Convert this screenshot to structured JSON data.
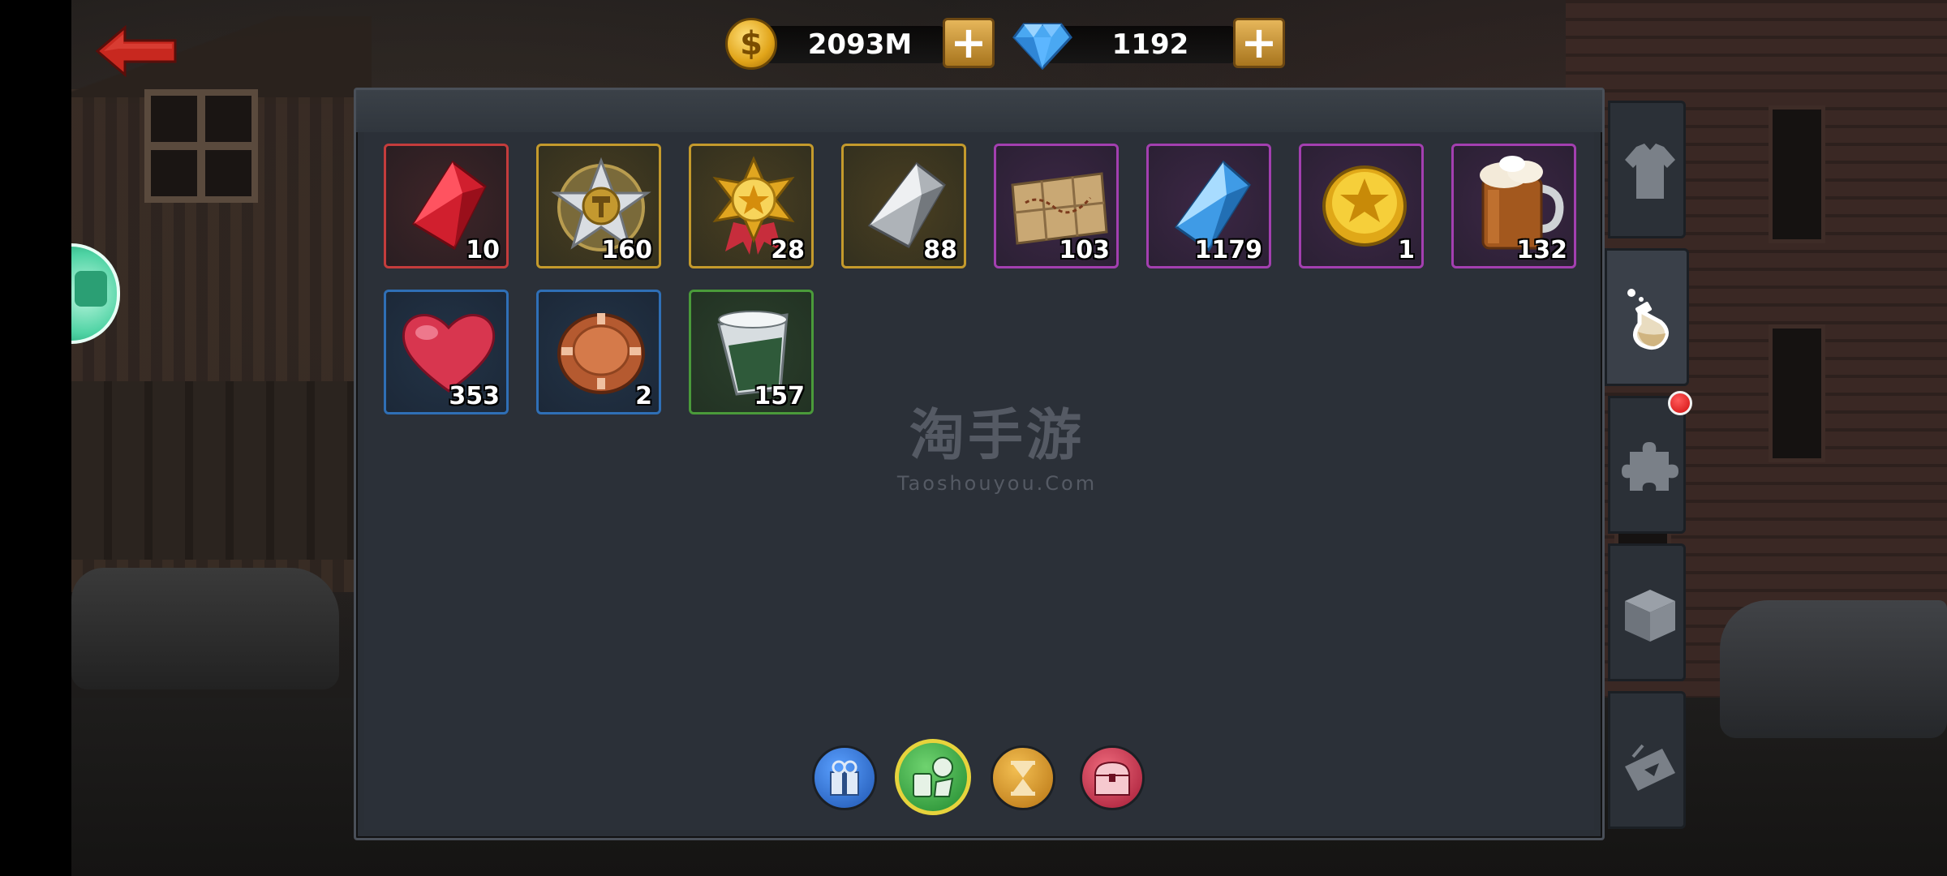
{
  "currency": {
    "gold": {
      "icon": "coin-icon",
      "symbol": "$",
      "amount": "2093M",
      "add_label": "+"
    },
    "gems": {
      "icon": "diamond-icon",
      "amount": "1192",
      "add_label": "+"
    }
  },
  "navigation": {
    "back": "back-arrow-icon"
  },
  "inventory": {
    "items": [
      {
        "name": "red-crystal",
        "count": "10",
        "rarity": "red"
      },
      {
        "name": "hammer-star-badge",
        "count": "160",
        "rarity": "gold"
      },
      {
        "name": "gold-star-medal",
        "count": "28",
        "rarity": "gold"
      },
      {
        "name": "silver-crystal",
        "count": "88",
        "rarity": "gold"
      },
      {
        "name": "treasure-map",
        "count": "103",
        "rarity": "purple"
      },
      {
        "name": "blue-crystal",
        "count": "1179",
        "rarity": "purple"
      },
      {
        "name": "gold-star-coin",
        "count": "1",
        "rarity": "purple"
      },
      {
        "name": "beer-mug",
        "count": "132",
        "rarity": "purple"
      },
      {
        "name": "heart",
        "count": "353",
        "rarity": "blue"
      },
      {
        "name": "bronze-chip",
        "count": "2",
        "rarity": "blue"
      },
      {
        "name": "shot-glass",
        "count": "157",
        "rarity": "green"
      }
    ]
  },
  "watermark": {
    "cn": "淘手游",
    "en": "Taoshouyou.Com"
  },
  "categories": [
    {
      "name": "gift-box-icon",
      "color": "#2f6fd0"
    },
    {
      "name": "consumables-icon",
      "color": "#3aa54a",
      "active": true
    },
    {
      "name": "hourglass-icon",
      "color": "#d6982a"
    },
    {
      "name": "treasure-chest-icon",
      "color": "#c8334c"
    }
  ],
  "side_tabs": [
    {
      "name": "shirt-icon"
    },
    {
      "name": "potion-icon",
      "active": true
    },
    {
      "name": "puzzle-piece-icon",
      "notification": true
    },
    {
      "name": "box-icon"
    },
    {
      "name": "ticket-icon"
    }
  ],
  "colors": {
    "panel": "#2b3038",
    "rarity_red": "#c43c3c",
    "rarity_gold": "#c49a2c",
    "rarity_purple": "#a33fb0",
    "rarity_blue": "#2f6fb6",
    "rarity_green": "#4a9a3a",
    "notification": "#d10f0f"
  }
}
